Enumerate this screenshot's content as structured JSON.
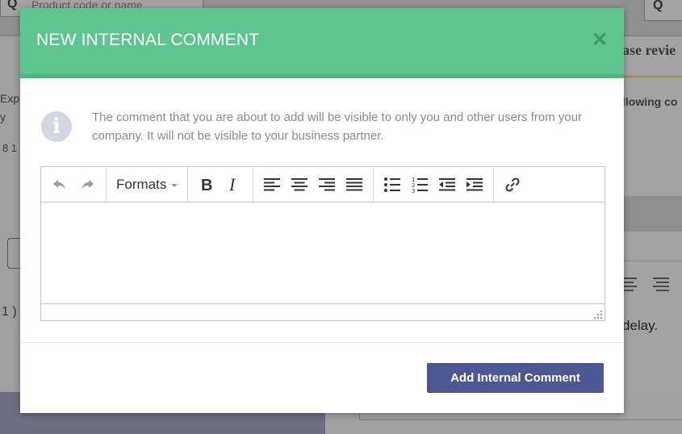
{
  "background": {
    "search_placeholder": "Product code or name",
    "tab_label_partial": "ase revie",
    "left_text_1": "Exp",
    "left_text_2": "y",
    "left_text_3": "8 1",
    "left_text_4": "1 )",
    "right_text_1": "llowing co",
    "right_text_2": "delay."
  },
  "modal": {
    "title": "NEW INTERNAL COMMENT",
    "close_icon": "close-icon",
    "info_icon": "info-icon",
    "info_text": "The comment that you are about to add will be visible to only you and other users from your company. It will not be visible to your business partner.",
    "editor": {
      "formats_label": "Formats",
      "content": ""
    },
    "submit_label": "Add Internal Comment"
  },
  "colors": {
    "header": "#5dc58d",
    "primary_button": "#4c5893",
    "info_text": "#8b8b8b"
  }
}
